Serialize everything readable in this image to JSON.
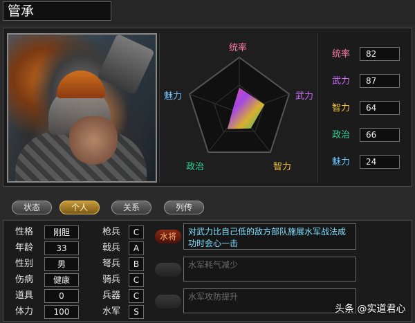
{
  "general": {
    "name": "管承"
  },
  "radar": {
    "labels": {
      "leadership": "统率",
      "war": "武力",
      "intellect": "智力",
      "politics": "政治",
      "charm": "魅力"
    },
    "colors": {
      "leadership": "#ff7aa8",
      "war": "#cc6cff",
      "intellect": "#f3c13a",
      "politics": "#35d39a",
      "charm": "#6ec3ff"
    }
  },
  "stats": [
    {
      "label": "统率",
      "value": "82",
      "color": "#ff7aa8"
    },
    {
      "label": "武力",
      "value": "87",
      "color": "#cc6cff"
    },
    {
      "label": "智力",
      "value": "64",
      "color": "#f3c13a"
    },
    {
      "label": "政治",
      "value": "66",
      "color": "#35d39a"
    },
    {
      "label": "魅力",
      "value": "24",
      "color": "#6ec3ff"
    }
  ],
  "tabs": [
    {
      "label": "状态",
      "active": false
    },
    {
      "label": "个人",
      "active": true
    },
    {
      "label": "关系",
      "active": false
    },
    {
      "label": "列传",
      "active": false
    }
  ],
  "personal": [
    {
      "label": "性格",
      "value": "刚胆"
    },
    {
      "label": "年龄",
      "value": "33"
    },
    {
      "label": "性别",
      "value": "男"
    },
    {
      "label": "伤病",
      "value": "健康"
    },
    {
      "label": "道具",
      "value": "0"
    },
    {
      "label": "体力",
      "value": "100"
    }
  ],
  "aptitude": [
    {
      "label": "枪兵",
      "grade": "C"
    },
    {
      "label": "戟兵",
      "grade": "A"
    },
    {
      "label": "弩兵",
      "grade": "B"
    },
    {
      "label": "骑兵",
      "grade": "C"
    },
    {
      "label": "兵器",
      "grade": "C"
    },
    {
      "label": "水军",
      "grade": "S"
    }
  ],
  "skills": [
    {
      "tag": "水将",
      "text": "对武力比自己低的敌方部队施展水军战法成功时会心一击",
      "active": true
    },
    {
      "tag": "",
      "text": "水军耗气减少",
      "active": false
    },
    {
      "tag": "",
      "text": "水军攻防提升",
      "active": false
    }
  ],
  "watermark": "头条 @实道君心"
}
